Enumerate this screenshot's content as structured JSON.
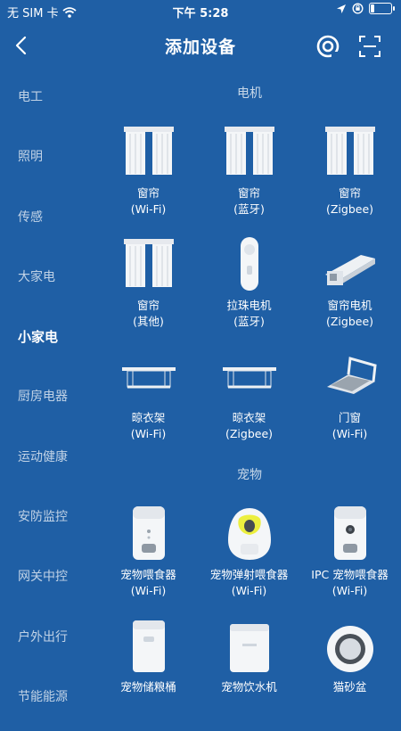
{
  "status_bar": {
    "carrier": "无 SIM 卡",
    "time": "下午 5:28"
  },
  "header": {
    "title": "添加设备"
  },
  "categories": [
    "电工",
    "照明",
    "传感",
    "大家电",
    "小家电",
    "厨房电器",
    "运动健康",
    "安防监控",
    "网关中控",
    "户外出行",
    "节能能源"
  ],
  "active_category": "小家电",
  "sections": [
    {
      "title": "电机",
      "devices": [
        {
          "name": "窗帘",
          "sub": "(Wi-Fi)",
          "icon": "curtain-icon"
        },
        {
          "name": "窗帘",
          "sub": "(蓝牙)",
          "icon": "curtain-icon"
        },
        {
          "name": "窗帘",
          "sub": "(Zigbee)",
          "icon": "curtain-icon"
        },
        {
          "name": "窗帘",
          "sub": "(其他)",
          "icon": "curtain-icon"
        },
        {
          "name": "拉珠电机",
          "sub": "(蓝牙)",
          "icon": "bead-motor-icon"
        },
        {
          "name": "窗帘电机",
          "sub": "(Zigbee)",
          "icon": "rail-motor-icon"
        },
        {
          "name": "晾衣架",
          "sub": "(Wi-Fi)",
          "icon": "drying-rack-icon"
        },
        {
          "name": "晾衣架",
          "sub": "(Zigbee)",
          "icon": "drying-rack-icon"
        },
        {
          "name": "门窗",
          "sub": "(Wi-Fi)",
          "icon": "window-opener-icon"
        }
      ]
    },
    {
      "title": "宠物",
      "devices": [
        {
          "name": "宠物喂食器",
          "sub": "(Wi-Fi)",
          "icon": "pet-feeder-icon"
        },
        {
          "name": "宠物弹射喂食器",
          "sub": "(Wi-Fi)",
          "icon": "pet-launcher-icon"
        },
        {
          "name": "IPC 宠物喂食器",
          "sub": "(Wi-Fi)",
          "icon": "ipc-feeder-icon"
        },
        {
          "name": "宠物储粮桶",
          "sub": "",
          "icon": "food-bucket-icon"
        },
        {
          "name": "宠物饮水机",
          "sub": "",
          "icon": "water-dispenser-icon"
        },
        {
          "name": "猫砂盆",
          "sub": "",
          "icon": "litter-box-icon"
        }
      ]
    }
  ]
}
